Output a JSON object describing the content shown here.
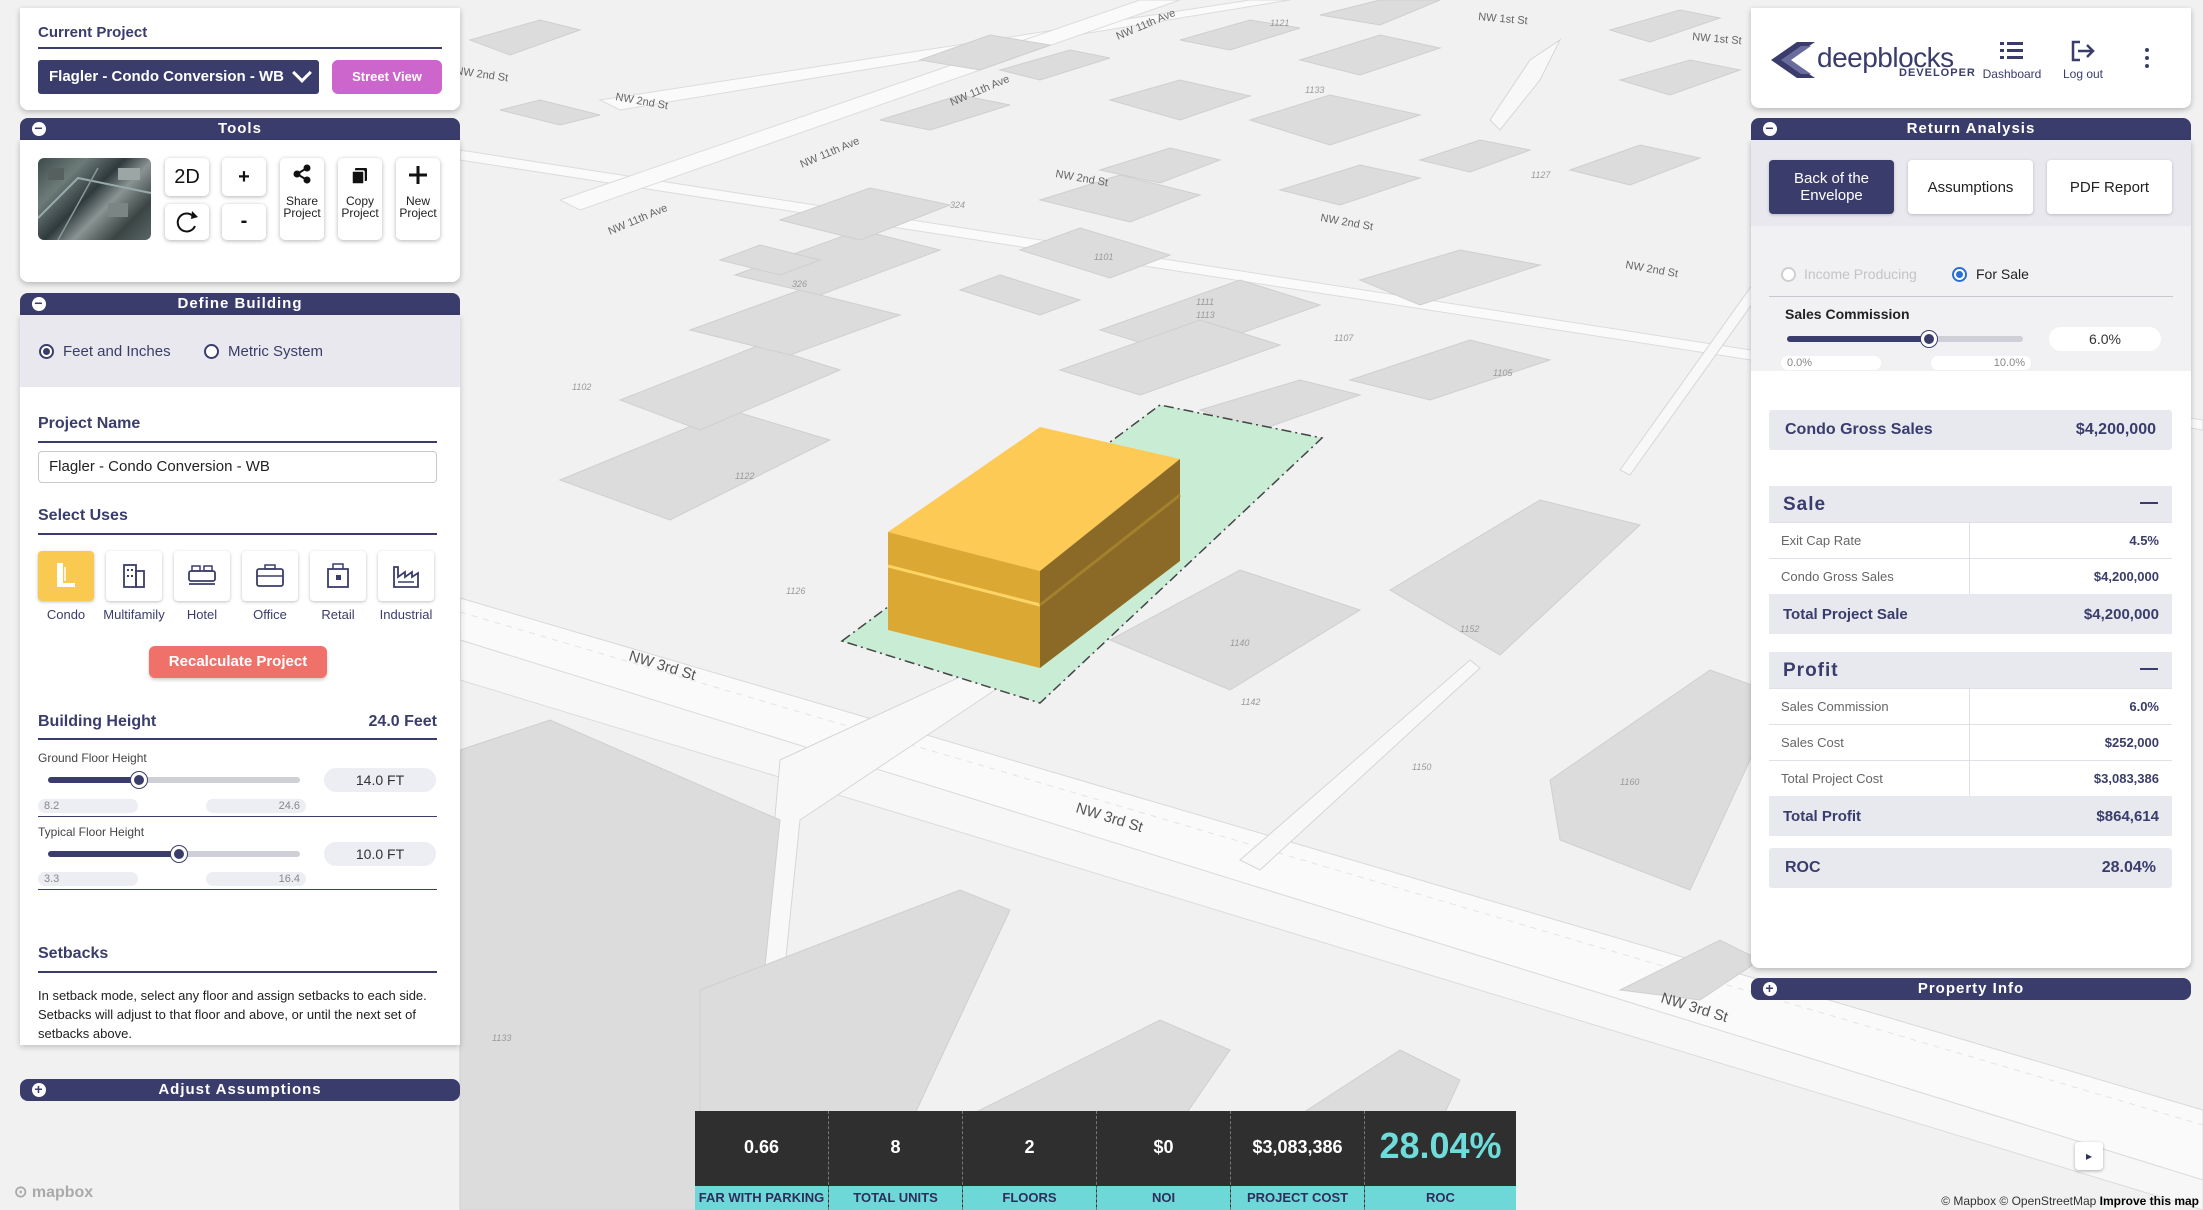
{
  "current_project": {
    "title": "Current Project",
    "selected_project": "Flagler - Condo Conversion - WB",
    "street_view_label": "Street View"
  },
  "tools": {
    "title": "Tools",
    "btn_2d": "2D",
    "btn_zoom_in": "+",
    "btn_zoom_out": "-",
    "share_label": "Share\nProject",
    "share_l1": "Share",
    "share_l2": "Project",
    "copy_l1": "Copy",
    "copy_l2": "Project",
    "new_l1": "New",
    "new_l2": "Project"
  },
  "define_building": {
    "title": "Define Building",
    "unit_imperial": "Feet and Inches",
    "unit_metric": "Metric System",
    "project_name_label": "Project Name",
    "project_name_value": "Flagler - Condo Conversion - WB",
    "select_uses_label": "Select Uses",
    "uses": [
      "Condo",
      "Multifamily",
      "Hotel",
      "Office",
      "Retail",
      "Industrial"
    ],
    "recalculate_label": "Recalculate Project",
    "building_height_label": "Building Height",
    "building_height_value": "24.0 Feet",
    "ground_floor_label": "Ground Floor Height",
    "ground_floor_value": "14.0 FT",
    "ground_floor_min": "8.2",
    "ground_floor_max": "24.6",
    "ground_floor_fraction": 0.36,
    "typical_floor_label": "Typical Floor Height",
    "typical_floor_value": "10.0 FT",
    "typical_floor_min": "3.3",
    "typical_floor_max": "16.4",
    "typical_floor_fraction": 0.52,
    "setbacks_label": "Setbacks",
    "setbacks_text": "In setback mode, select any floor and assign setbacks to each side. Setbacks will adjust to that floor and above, or until the next set of setbacks above."
  },
  "adjust_assumptions": {
    "title": "Adjust Assumptions"
  },
  "header": {
    "logo_text": "deepblocks",
    "logo_sub": "DEVELOPER",
    "dashboard_label": "Dashboard",
    "logout_label": "Log out"
  },
  "return_analysis": {
    "title": "Return Analysis",
    "tabs": [
      "Back of the Envelope",
      "Assumptions",
      "PDF Report"
    ],
    "mode_income": "Income Producing",
    "mode_sale": "For Sale",
    "sales_commission_label": "Sales Commission",
    "sales_commission_value": "6.0%",
    "sales_commission_min": "0.0%",
    "sales_commission_max": "10.0%",
    "sales_commission_fraction": 0.6,
    "condo_gross_sales_label": "Condo Gross Sales",
    "condo_gross_sales_value": "$4,200,000",
    "sale": {
      "title": "Sale",
      "rows": [
        {
          "label": "Exit Cap Rate",
          "value": "4.5%"
        },
        {
          "label": "Condo Gross Sales",
          "value": "$4,200,000"
        }
      ],
      "total_label": "Total Project Sale",
      "total_value": "$4,200,000"
    },
    "profit": {
      "title": "Profit",
      "rows": [
        {
          "label": "Sales Commission",
          "value": "6.0%"
        },
        {
          "label": "Sales Cost",
          "value": "$252,000"
        },
        {
          "label": "Total Project Cost",
          "value": "$3,083,386"
        }
      ],
      "total_label": "Total Profit",
      "total_value": "$864,614"
    },
    "roc_label": "ROC",
    "roc_value": "28.04%"
  },
  "property_info": {
    "title": "Property Info"
  },
  "stats": [
    {
      "value": "0.66",
      "label": "FAR WITH PARKING"
    },
    {
      "value": "8",
      "label": "TOTAL UNITS"
    },
    {
      "value": "2",
      "label": "FLOORS"
    },
    {
      "value": "$0",
      "label": "NOI"
    },
    {
      "value": "$3,083,386",
      "label": "PROJECT COST"
    },
    {
      "value": "28.04%",
      "label": "ROC"
    }
  ],
  "map": {
    "streets": [
      "NW 3rd St",
      "NW 3rd St",
      "NW 3rd St",
      "NW 2nd St",
      "NW 2nd St",
      "NW 2nd St",
      "NW 2nd St",
      "NW 11th Ave",
      "NW 11th Ave",
      "NW 11th Ave",
      "NW 11th Ave",
      "NW 1st St",
      "NW 1st St",
      "NW 2nd St"
    ],
    "lot_numbers": [
      "1122",
      "1126",
      "1140",
      "1142",
      "1152",
      "1150",
      "1160",
      "1133",
      "1101",
      "1111",
      "1113",
      "1107",
      "1105",
      "1127",
      "1133",
      "324",
      "326",
      "1121",
      "1102"
    ],
    "mapbox_logo": "mapbox",
    "attribution": "© Mapbox © OpenStreetMap",
    "improve": "Improve this map",
    "colors": {
      "building": "#fac94f",
      "lot": "#c9ecd5"
    }
  }
}
